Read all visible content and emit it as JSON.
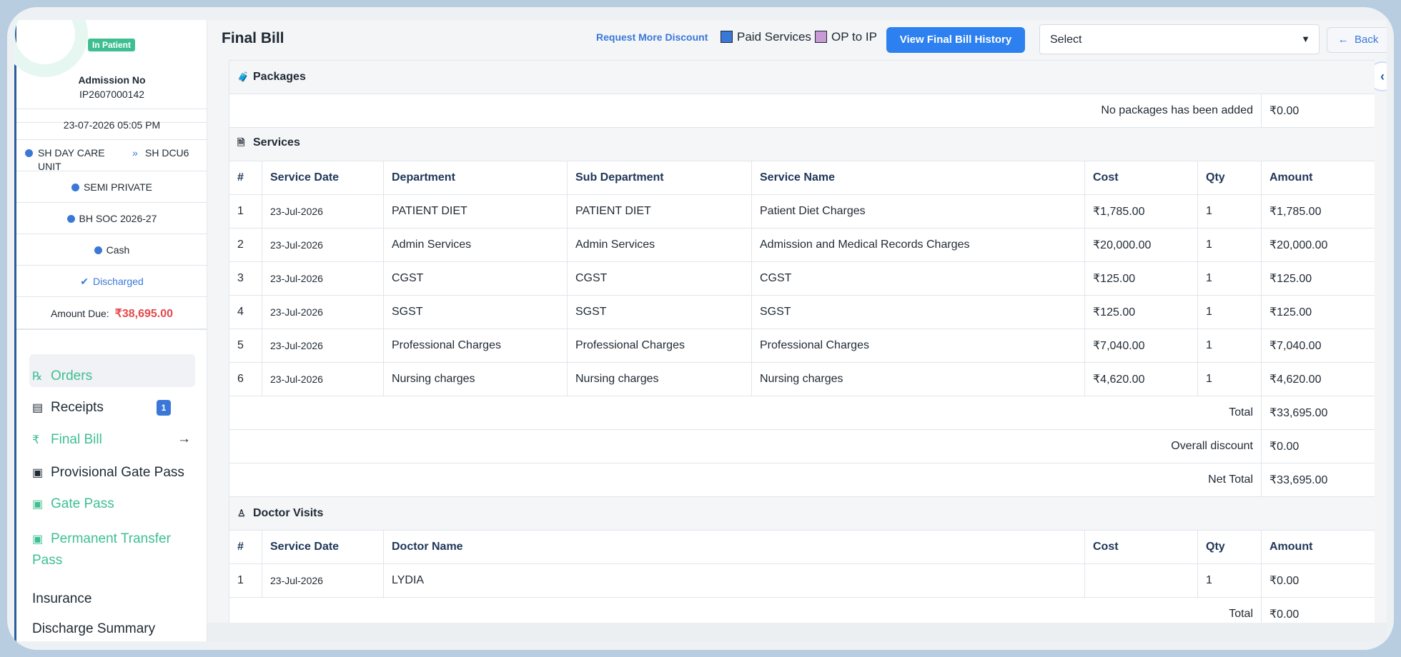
{
  "sidebar": {
    "status_badge": "In Patient",
    "admission_label": "Admission No",
    "admission_no": "IP2607000142",
    "datetime": "23-07-2026 05:05 PM",
    "unit_left": "SH DAY CARE UNIT",
    "unit_right": "SH DCU6",
    "room_type": "SEMI PRIVATE",
    "scheme": "BH SOC 2026-27",
    "payment_mode": "Cash",
    "discharge_status": "Discharged",
    "amount_due_label": "Amount Due:",
    "amount_due_value": "₹38,695.00",
    "nav": {
      "orders": "Orders",
      "receipts": "Receipts",
      "receipts_count": "1",
      "final_bill": "Final Bill",
      "provisional_gate_pass": "Provisional Gate Pass",
      "gate_pass": "Gate Pass",
      "permanent_transfer_pass_1": "Permanent Transfer",
      "permanent_transfer_pass_2": "Pass",
      "insurance": "Insurance",
      "discharge_summary": "Discharge Summary"
    }
  },
  "header": {
    "title": "Final Bill",
    "request_discount": "Request More Discount",
    "legend_paid": "Paid Services",
    "legend_op_ip": "OP to IP",
    "history_button": "View Final Bill History",
    "select_value": "Select",
    "back_button": "Back",
    "colors": {
      "paid": "#3a78d8",
      "op_ip": "#c89bd6"
    }
  },
  "packages": {
    "title": "Packages",
    "empty_text": "No packages has been added",
    "amount": "₹0.00"
  },
  "services": {
    "title": "Services",
    "columns": [
      "#",
      "Service Date",
      "Department",
      "Sub Department",
      "Service Name",
      "Cost",
      "Qty",
      "Amount"
    ],
    "rows": [
      [
        "1",
        "23-Jul-2026",
        "PATIENT DIET",
        "PATIENT DIET",
        "Patient Diet Charges",
        "₹1,785.00",
        "1",
        "₹1,785.00"
      ],
      [
        "2",
        "23-Jul-2026",
        "Admin Services",
        "Admin Services",
        "Admission and Medical Records Charges",
        "₹20,000.00",
        "1",
        "₹20,000.00"
      ],
      [
        "3",
        "23-Jul-2026",
        "CGST",
        "CGST",
        "CGST",
        "₹125.00",
        "1",
        "₹125.00"
      ],
      [
        "4",
        "23-Jul-2026",
        "SGST",
        "SGST",
        "SGST",
        "₹125.00",
        "1",
        "₹125.00"
      ],
      [
        "5",
        "23-Jul-2026",
        "Professional Charges",
        "Professional Charges",
        "Professional Charges",
        "₹7,040.00",
        "1",
        "₹7,040.00"
      ],
      [
        "6",
        "23-Jul-2026",
        "Nursing charges",
        "Nursing charges",
        "Nursing charges",
        "₹4,620.00",
        "1",
        "₹4,620.00"
      ]
    ],
    "total_label": "Total",
    "total_value": "₹33,695.00",
    "discount_label": "Overall discount",
    "discount_value": "₹0.00",
    "net_label": "Net Total",
    "net_value": "₹33,695.00"
  },
  "doctor_visits": {
    "title": "Doctor Visits",
    "columns": [
      "#",
      "Service Date",
      "Doctor Name",
      "Cost",
      "Qty",
      "Amount"
    ],
    "rows": [
      [
        "1",
        "23-Jul-2026",
        "LYDIA",
        "",
        "1",
        "₹0.00"
      ]
    ],
    "total_label": "Total",
    "total_value": "₹0.00"
  }
}
